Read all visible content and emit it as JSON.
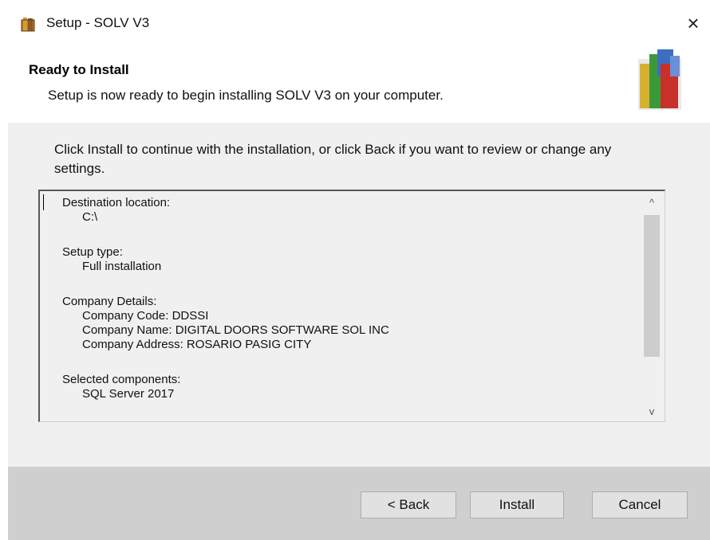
{
  "window": {
    "title": "Setup - SOLV V3",
    "close_glyph": "×"
  },
  "header": {
    "title": "Ready to Install",
    "subtitle": "Setup is now ready to begin installing SOLV V3 on your computer."
  },
  "main": {
    "instruction": "Click Install to continue with the installation, or click Back if you want to review or change any settings.",
    "memo_lines": [
      "Destination location:",
      "      C:\\",
      "",
      "Setup type:",
      "      Full installation",
      "",
      "Company Details:",
      "      Company Code: DDSSI",
      "      Company Name: DIGITAL DOORS SOFTWARE SOL INC",
      "      Company Address: ROSARIO PASIG CITY",
      "",
      "Selected components:",
      "      SQL Server 2017"
    ],
    "scroll_up_glyph": "^",
    "scroll_down_glyph": "v"
  },
  "buttons": {
    "back": "< Back",
    "install": "Install",
    "cancel": "Cancel"
  },
  "colors": {
    "body_bg": "#f0f0f0",
    "footer_bg": "#cfcfcf",
    "button_bg": "#e1e1e1"
  }
}
